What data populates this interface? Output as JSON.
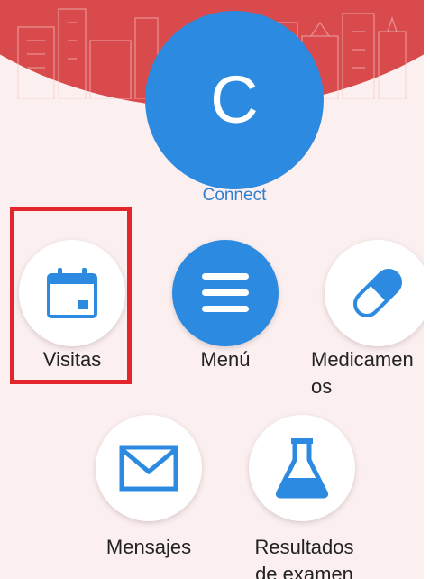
{
  "header": {
    "avatar_letter": "C",
    "connect_label": "Connect"
  },
  "tiles": [
    {
      "label": "Visitas",
      "icon": "calendar-icon"
    },
    {
      "label": "Menú",
      "icon": "hamburger-menu-icon"
    },
    {
      "label": "Medicamen\nos",
      "icon": "pill-capsule-icon"
    },
    {
      "label": "Mensajes",
      "icon": "envelope-icon"
    },
    {
      "label": "Resultados\nde examen",
      "icon": "flask-icon"
    }
  ],
  "colors": {
    "accent": "#2c8ae0",
    "banner": "#d84a4c",
    "background": "#fbefef",
    "highlight": "#e3262c"
  }
}
